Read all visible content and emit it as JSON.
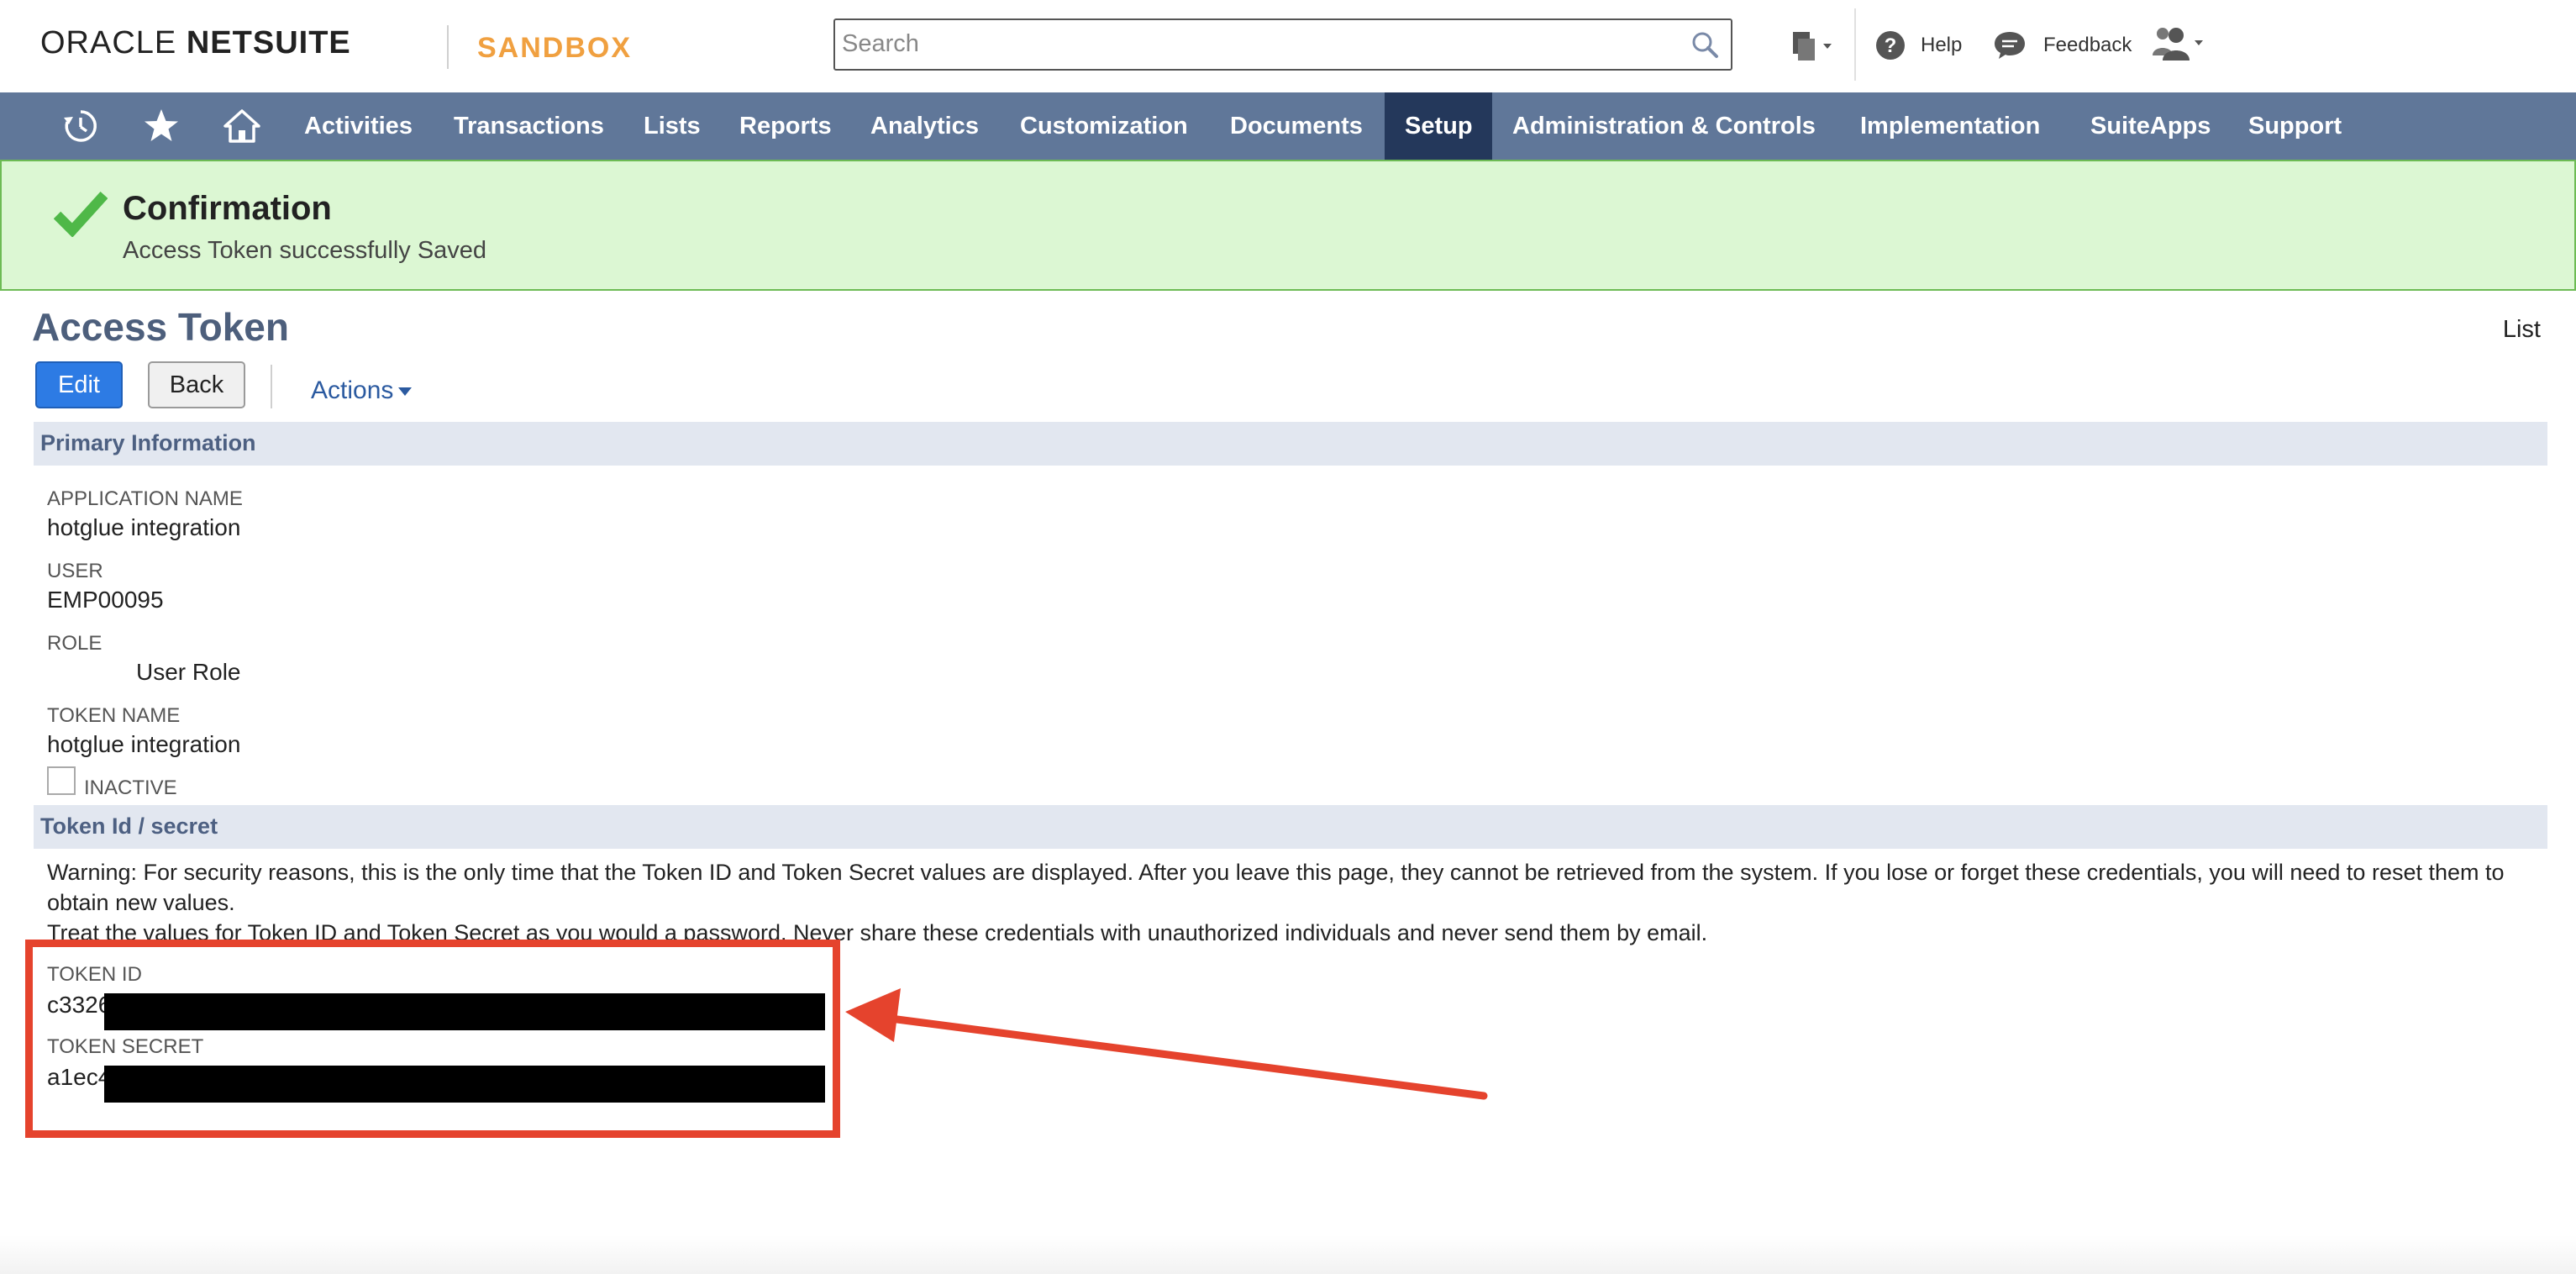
{
  "header": {
    "brand_oracle": "ORACLE",
    "brand_netsuite": "NETSUITE",
    "environment": "SANDBOX",
    "search_placeholder": "Search",
    "help_label": "Help",
    "feedback_label": "Feedback"
  },
  "nav": {
    "items": [
      {
        "label": "Activities"
      },
      {
        "label": "Transactions"
      },
      {
        "label": "Lists"
      },
      {
        "label": "Reports"
      },
      {
        "label": "Analytics"
      },
      {
        "label": "Customization"
      },
      {
        "label": "Documents"
      },
      {
        "label": "Setup",
        "active": true
      },
      {
        "label": "Administration & Controls"
      },
      {
        "label": "Implementation"
      },
      {
        "label": "SuiteApps"
      },
      {
        "label": "Support"
      }
    ]
  },
  "confirmation": {
    "title": "Confirmation",
    "message": "Access Token successfully Saved"
  },
  "page": {
    "title": "Access Token",
    "list_link": "List",
    "edit_button": "Edit",
    "back_button": "Back",
    "actions_label": "Actions"
  },
  "primary_info": {
    "section_title": "Primary Information",
    "application_name_label": "APPLICATION NAME",
    "application_name_value": "hotglue integration",
    "user_label": "USER",
    "user_value": "EMP00095",
    "role_label": "ROLE",
    "role_value": "User Role",
    "token_name_label": "TOKEN NAME",
    "token_name_value": "hotglue integration",
    "inactive_label": "INACTIVE"
  },
  "token_secret": {
    "section_title": "Token Id / secret",
    "warning_line1": "Warning: For security reasons, this is the only time that the Token ID and Token Secret values are displayed. After you leave this page, they cannot be retrieved from the system. If you lose or forget these credentials, you will need to reset them to obtain new values.",
    "warning_line2": "Treat the values for Token ID and Token Secret as you would a password. Never share these credentials with unauthorized individuals and never send them by email.",
    "token_id_label": "TOKEN ID",
    "token_id_visible": "c3326",
    "token_secret_label": "TOKEN SECRET",
    "token_secret_visible": "a1ec4"
  },
  "colors": {
    "nav_bg": "#607799",
    "nav_active": "#24385b",
    "confirm_bg": "#dcf7d3",
    "annotation_red": "#e5432d",
    "sandbox_orange": "#f0a040"
  }
}
